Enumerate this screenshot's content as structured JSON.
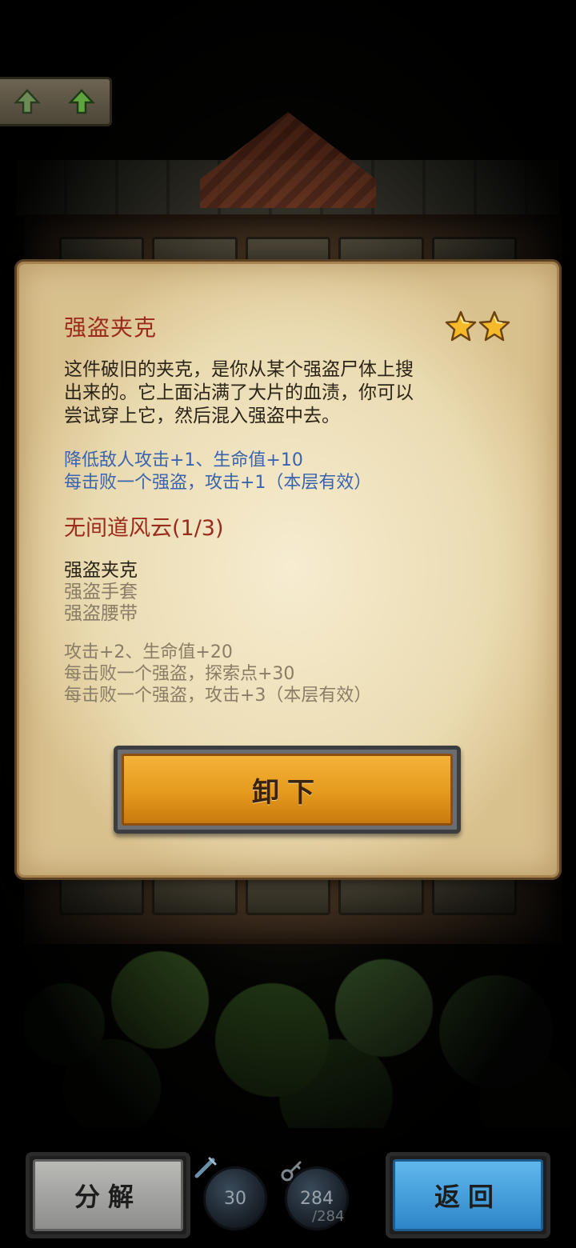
{
  "item": {
    "name": "强盗夹克",
    "rarity_stars": 2,
    "description": [
      "这件破旧的夹克，是你从某个强盗尸体上搜",
      "出来的。它上面沾满了大片的血渍，你可以",
      "尝试穿上它，然后混入强盗中去。"
    ],
    "effects": [
      "降低敌人攻击+1、生命值+10",
      "每击败一个强盗，攻击+1（本层有效）"
    ]
  },
  "set": {
    "title": "无间道风云(1/3)",
    "pieces": [
      {
        "name": "强盗夹克",
        "owned": true
      },
      {
        "name": "强盗手套",
        "owned": false
      },
      {
        "name": "强盗腰带",
        "owned": false
      }
    ],
    "bonuses": [
      "攻击+2、生命值+20",
      "每击败一个强盗，探索点+30",
      "每击败一个强盗，攻击+3（本层有效）"
    ]
  },
  "buttons": {
    "unequip": "卸下",
    "decompose": "分解",
    "back": "返回"
  },
  "resources": {
    "gems": "30",
    "keys": "284",
    "keys_max": "/284"
  },
  "colors": {
    "title_red": "#9b2a1c",
    "effect_blue": "#3a63b0",
    "unequip_orange": "#e59a1c",
    "back_blue": "#2e86c9",
    "decompose_gray": "#8e8f8c"
  }
}
